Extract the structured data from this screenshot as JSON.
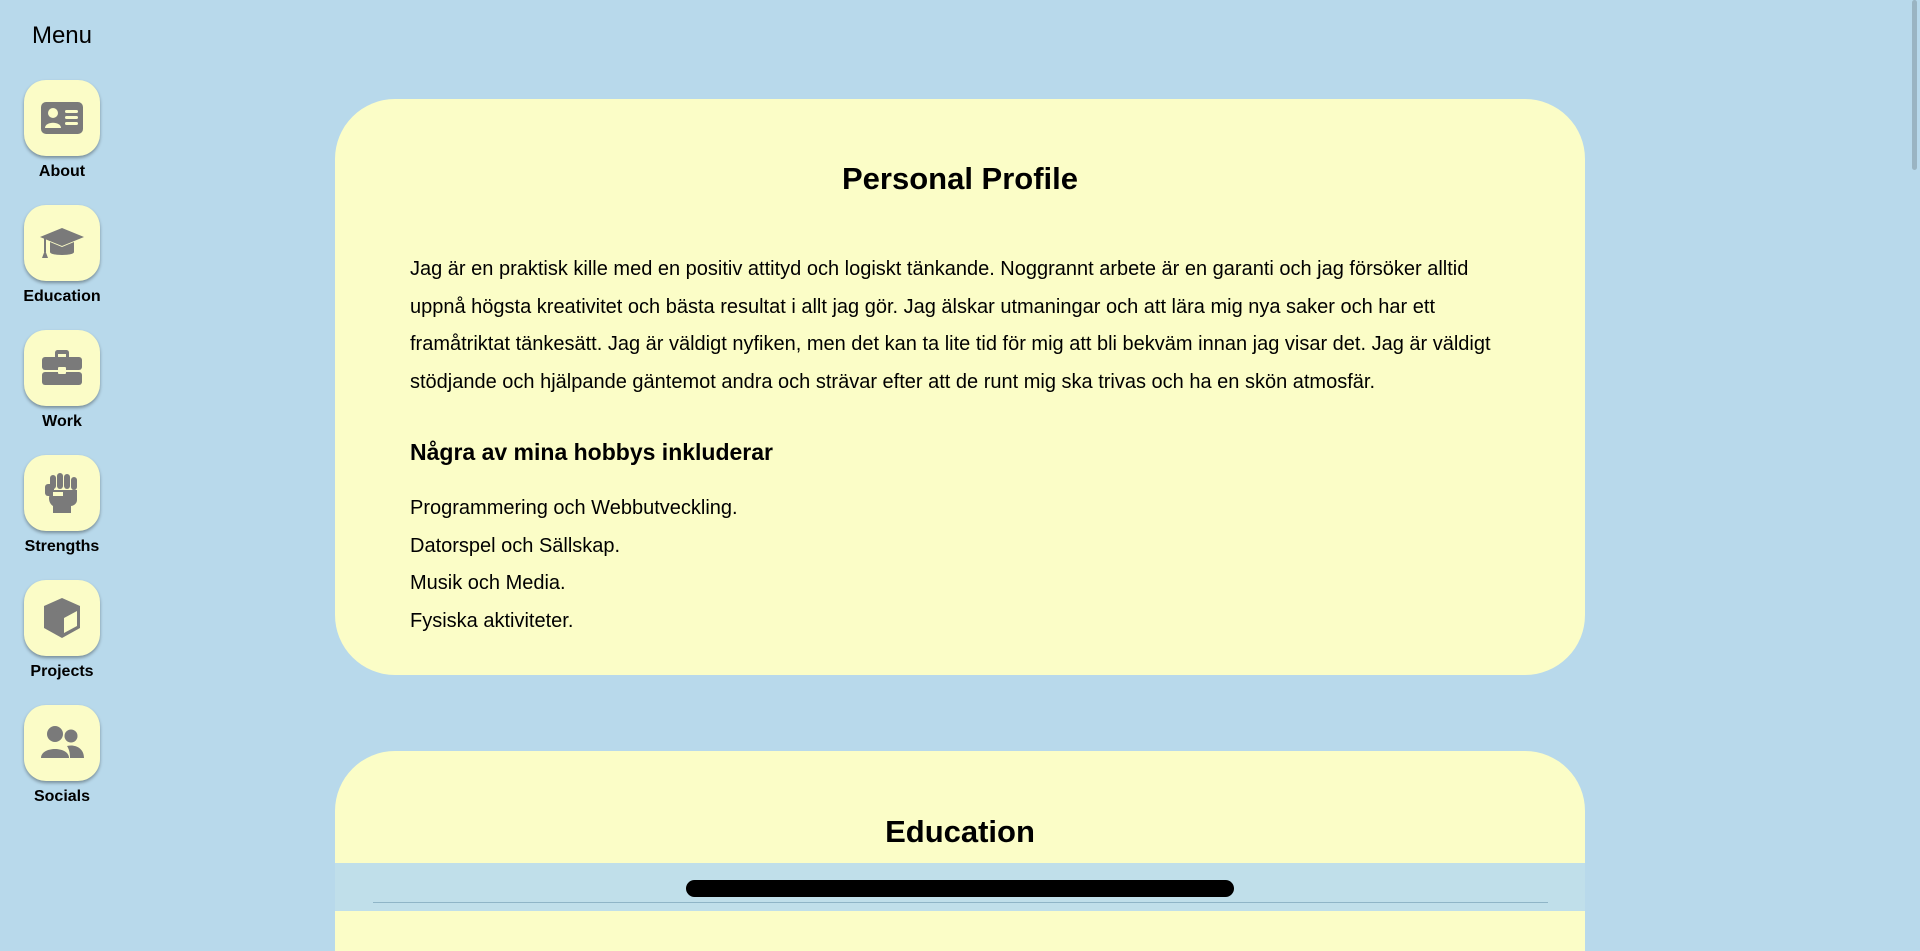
{
  "sidebar": {
    "title": "Menu",
    "items": [
      {
        "label": "About",
        "icon": "id-card-icon"
      },
      {
        "label": "Education",
        "icon": "graduation-cap-icon"
      },
      {
        "label": "Work",
        "icon": "briefcase-icon"
      },
      {
        "label": "Strengths",
        "icon": "fist-icon"
      },
      {
        "label": "Projects",
        "icon": "cube-icon"
      },
      {
        "label": "Socials",
        "icon": "users-icon"
      }
    ]
  },
  "profile": {
    "title": "Personal Profile",
    "text": "Jag är en praktisk kille med en positiv attityd och logiskt tänkande. Noggrannt arbete är en garanti och jag försöker alltid uppnå högsta kreativitet och bästa resultat i allt jag gör. Jag älskar utmaningar och att lära mig nya saker och har ett framåtriktat tänkesätt. Jag är väldigt nyfiken, men det kan ta lite tid för mig att bli bekväm innan jag visar det. Jag är väldigt stödjande och hjälpande gäntemot andra och strävar efter att de runt mig ska trivas och ha en skön atmosfär.",
    "hobbies_heading": "Några av mina hobbys inkluderar",
    "hobbies": [
      "Programmering och Webbutveckling.",
      "Datorspel och Sällskap.",
      "Musik och Media.",
      "Fysiska aktiviteter."
    ]
  },
  "education": {
    "title": "Education"
  },
  "colors": {
    "background": "#b8d9eb",
    "card": "#fbfdc7",
    "icon": "#7a7a7a"
  }
}
